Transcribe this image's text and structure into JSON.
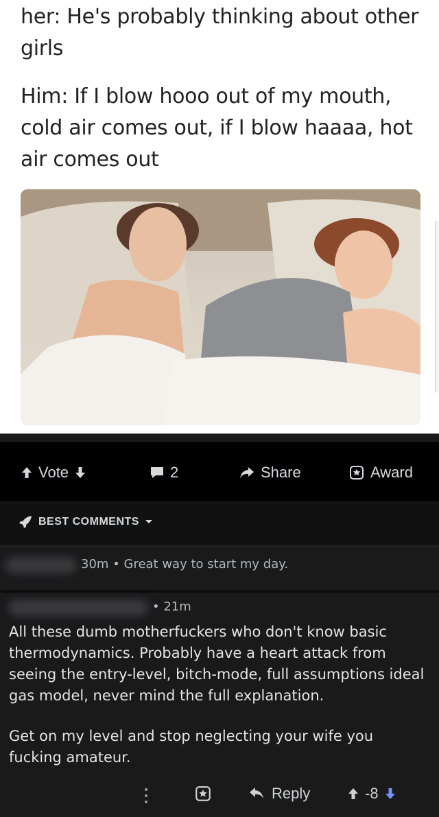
{
  "meme": {
    "line1": "her: He's probably thinking about other girls",
    "line2": "Him: If I blow hooo out of my mouth, cold air comes out, if I blow haaaa, hot air comes out"
  },
  "toolbar": {
    "vote_label": "Vote",
    "comment_count": "2",
    "share_label": "Share",
    "award_label": "Award"
  },
  "sort": {
    "label": "BEST COMMENTS"
  },
  "comments": [
    {
      "meta": "30m • Great way to start my day."
    },
    {
      "meta": "• 21m",
      "paragraph1": "All these dumb motherfuckers who don't know basic thermodynamics. Probably have a heart attack from seeing the entry-level, bitch-mode, full assumptions ideal gas model, never mind the full explanation.",
      "paragraph2": "Get on my level and stop neglecting your wife you fucking amateur.",
      "reply_label": "Reply",
      "score": "-8"
    }
  ],
  "colors": {
    "accent_down": "#7193ff",
    "text": "#d7dadc",
    "bg": "#1a1a1b"
  }
}
